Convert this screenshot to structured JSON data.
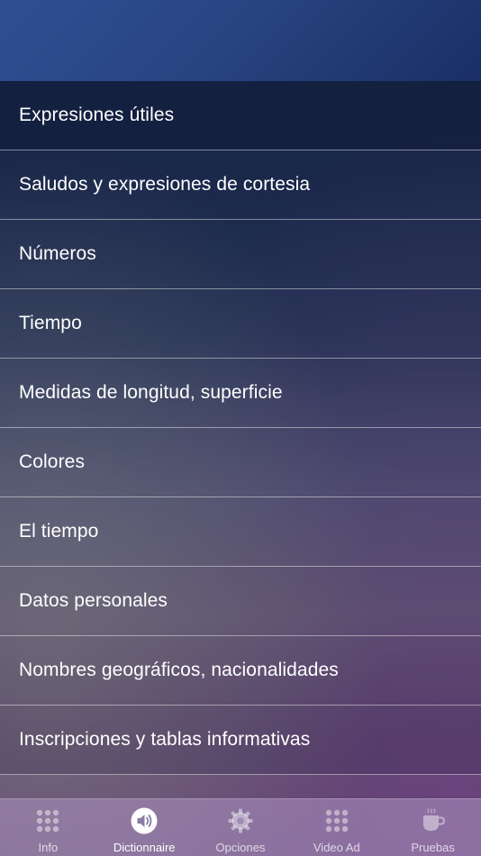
{
  "menu": {
    "items": [
      {
        "label": "Expresiones útiles"
      },
      {
        "label": "Saludos y expresiones de cortesia"
      },
      {
        "label": "Números"
      },
      {
        "label": "Tiempo"
      },
      {
        "label": "Medidas de longitud, superficie"
      },
      {
        "label": "Colores"
      },
      {
        "label": "El tiempo"
      },
      {
        "label": "Datos personales"
      },
      {
        "label": "Nombres geográficos, nacionalidades"
      },
      {
        "label": "Inscripciones y tablas informativas"
      }
    ]
  },
  "tabbar": {
    "tabs": [
      {
        "label": "Info",
        "icon": "grid-icon"
      },
      {
        "label": "Dictionnaire",
        "icon": "speaker-icon"
      },
      {
        "label": "Opciones",
        "icon": "gear-icon"
      },
      {
        "label": "Video Ad",
        "icon": "grid-icon"
      },
      {
        "label": "Pruebas",
        "icon": "coffee-cup-icon"
      }
    ],
    "active": "Dictionnaire"
  }
}
